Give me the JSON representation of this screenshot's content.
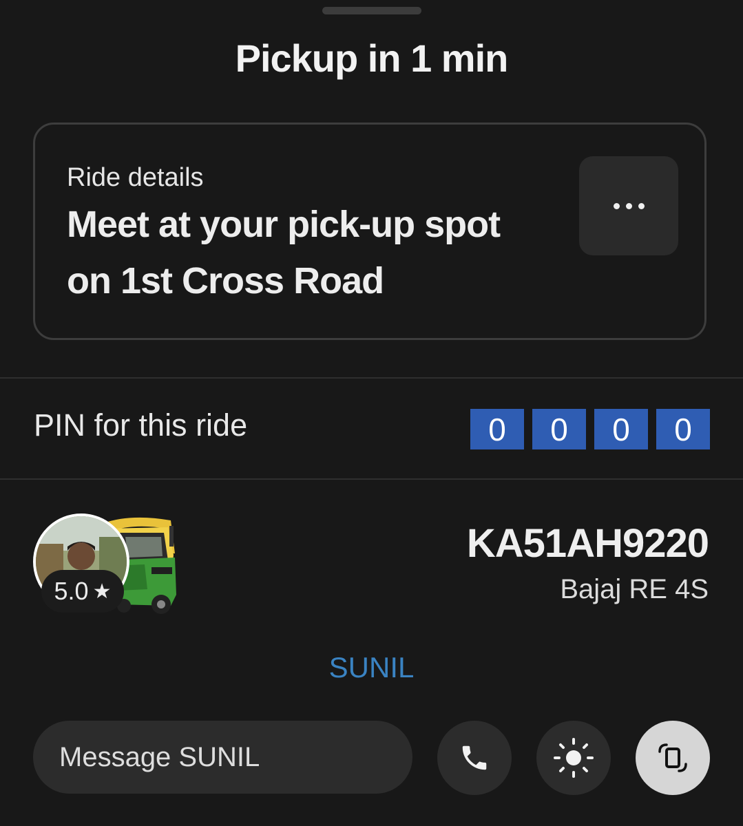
{
  "header": {
    "title": "Pickup in 1 min"
  },
  "ride_card": {
    "label": "Ride details",
    "line1": "Meet at your pick-up spot",
    "line2": "on 1st Cross Road",
    "more_icon": "more-horizontal-icon"
  },
  "pin": {
    "label": "PIN for this ride",
    "digits": [
      "0",
      "0",
      "0",
      "0"
    ],
    "color": "#2f5db3"
  },
  "driver": {
    "rating": "5.0",
    "rating_icon": "star-icon",
    "plate": "KA51AH9220",
    "vehicle_model": "Bajaj RE 4S",
    "name": "SUNIL",
    "name_color": "#3a83c2"
  },
  "actions": {
    "message_placeholder": "Message SUNIL",
    "call_icon": "phone-icon",
    "brightness_icon": "brightness-icon",
    "screen_icon": "screen-rotate-icon"
  },
  "theme": {
    "background": "#181818",
    "accent": "#3a83c2"
  }
}
